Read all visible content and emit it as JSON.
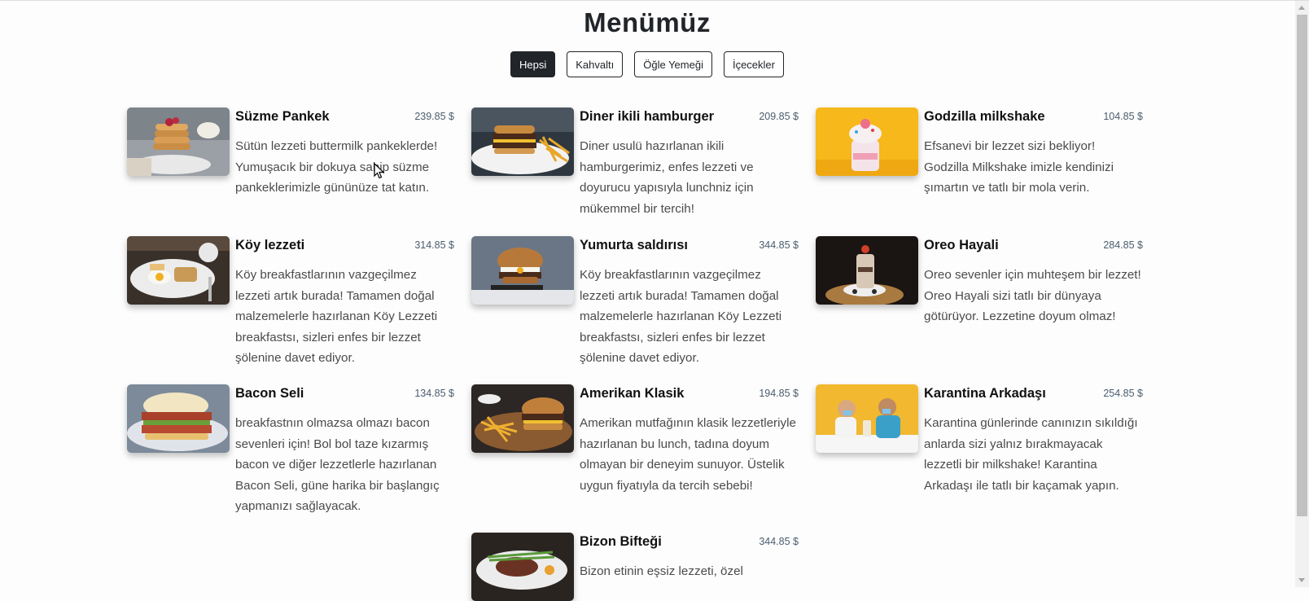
{
  "title": "Menümüz",
  "filters": [
    {
      "label": "Hepsi",
      "active": true
    },
    {
      "label": "Kahvaltı",
      "active": false
    },
    {
      "label": "Öğle Yemeği",
      "active": false
    },
    {
      "label": "İçecekler",
      "active": false
    }
  ],
  "items": [
    {
      "title": "Süzme Pankek",
      "price": "239.85 $",
      "desc": "Sütün lezzeti buttermilk pankeklerde! Yumuşacık bir dokuya sahip süzme pankeklerimizle gününüze tat katın.",
      "image": "pancake-image"
    },
    {
      "title": "Diner ikili hamburger",
      "price": "209.85 $",
      "desc": "Diner usulü hazırlanan ikili hamburgerimiz, enfes lezzeti ve doyurucu yapısıyla lunchniz için mükemmel bir tercih!",
      "image": "double-burger-image"
    },
    {
      "title": "Godzilla milkshake",
      "price": "104.85 $",
      "desc": "Efsanevi bir lezzet sizi bekliyor! Godzilla Milkshake imizle kendinizi şımartın ve tatlı bir mola verin.",
      "image": "milkshake-image"
    },
    {
      "title": "Köy lezzeti",
      "price": "314.85 $",
      "desc": "Köy breakfastlarının vazgeçilmez lezzeti artık burada! Tamamen doğal malzemelerle hazırlanan Köy Lezzeti breakfastsı, sizleri enfes bir lezzet şölenine davet ediyor.",
      "image": "breakfast-plate-image"
    },
    {
      "title": "Yumurta saldırısı",
      "price": "344.85 $",
      "desc": "Köy breakfastlarının vazgeçilmez lezzeti artık burada! Tamamen doğal malzemelerle hazırlanan Köy Lezzeti breakfastsı, sizleri enfes bir lezzet şölenine davet ediyor.",
      "image": "egg-burger-image"
    },
    {
      "title": "Oreo Hayali",
      "price": "284.85 $",
      "desc": "Oreo sevenler için muhteşem bir lezzet! Oreo Hayali sizi tatlı bir dünyaya götürüyor. Lezzetine doyum olmaz!",
      "image": "oreo-shake-image"
    },
    {
      "title": "Bacon Seli",
      "price": "134.85 $",
      "desc": "breakfastnın olmazsa olmazı bacon sevenleri için! Bol bol taze kızarmış bacon ve diğer lezzetlerle hazırlanan Bacon Seli, güne harika bir başlangıç yapmanızı sağlayacak.",
      "image": "bacon-sandwich-image"
    },
    {
      "title": "Amerikan Klasik",
      "price": "194.85 $",
      "desc": "Amerikan mutfağının klasik lezzetleriyle hazırlanan bu lunch, tadına doyum olmayan bir deneyim sunuyor. Üstelik uygun fiyatıyla da tercih sebebi!",
      "image": "burger-fries-image"
    },
    {
      "title": "Karantina Arkadaşı",
      "price": "254.85 $",
      "desc": "Karantina günlerinde canınızın sıkıldığı anlarda sizi yalnız bırakmayacak lezzetli bir milkshake! Karantina Arkadaşı ile tatlı bir kaçamak yapın.",
      "image": "couple-milkshake-image"
    },
    {
      "title": "Bizon Bifteği",
      "price": "344.85 $",
      "desc": "Bizon etinin eşsiz lezzeti, özel",
      "image": "steak-plate-image"
    }
  ]
}
